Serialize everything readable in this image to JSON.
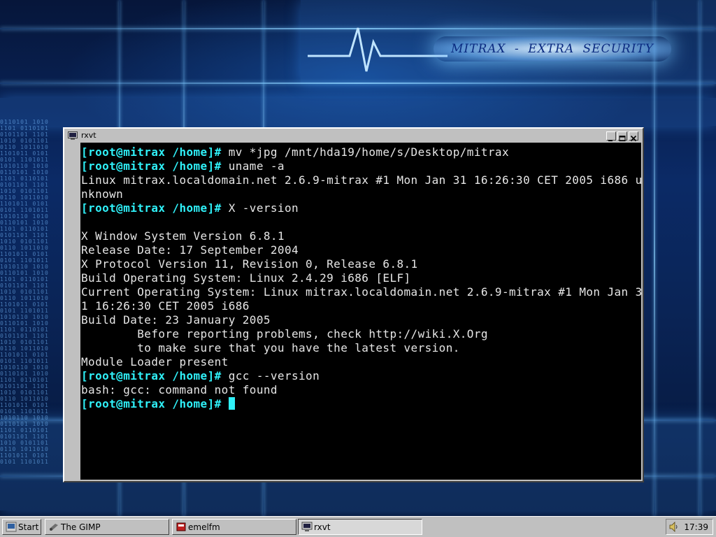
{
  "wallpaper": {
    "banner_text": "MITRAX - EXTRA SECURITY",
    "binary_text": "0110101 1010\n1101 0110101\n0101101 1101\n1010 0101101\n0110 1011010\n1101011 0101\n0101 1101011\n1010110 1010\n0110101 1010\n1101 0110101\n0101101 1101\n1010 0101101\n0110 1011010\n1101011 0101\n0101 1101011\n1010110 1010\n0110101 1010\n1101 0110101\n0101101 1101\n1010 0101101\n0110 1011010\n1101011 0101\n0101 1101011\n1010110 1010\n0110101 1010\n1101 0110101\n0101101 1101\n1010 0101101\n0110 1011010\n1101011 0101\n0101 1101011\n1010110 1010\n0110101 1010\n1101 0110101\n0101101 1101\n1010 0101101\n0110 1011010\n1101011 0101\n0101 1101011\n1010110 1010\n0110101 1010\n1101 0110101\n0101101 1101\n1010 0101101\n0110 1011010\n1101011 0101\n0101 1101011\n1010110 1010\n0110101 1010\n1101 0110101\n0101101 1101\n1010 0101101\n0110 1011010\n1101011 0101\n0101 1101011"
  },
  "window": {
    "title": "rxvt",
    "icon": "terminal-icon",
    "buttons": [
      "minimize",
      "maximize",
      "close"
    ]
  },
  "terminal": {
    "prompt": "[root@mitrax /home]#",
    "lines": [
      {
        "prompt": "[root@mitrax /home]#",
        "text": " mv *jpg /mnt/hda19/home/s/Desktop/mitrax"
      },
      {
        "prompt": "[root@mitrax /home]#",
        "text": " uname -a"
      },
      {
        "prompt": "",
        "text": "Linux mitrax.localdomain.net 2.6.9-mitrax #1 Mon Jan 31 16:26:30 CET 2005 i686 u"
      },
      {
        "prompt": "",
        "text": "nknown"
      },
      {
        "prompt": "[root@mitrax /home]#",
        "text": " X -version"
      },
      {
        "prompt": "",
        "text": ""
      },
      {
        "prompt": "",
        "text": "X Window System Version 6.8.1"
      },
      {
        "prompt": "",
        "text": "Release Date: 17 September 2004"
      },
      {
        "prompt": "",
        "text": "X Protocol Version 11, Revision 0, Release 6.8.1"
      },
      {
        "prompt": "",
        "text": "Build Operating System: Linux 2.4.29 i686 [ELF]"
      },
      {
        "prompt": "",
        "text": "Current Operating System: Linux mitrax.localdomain.net 2.6.9-mitrax #1 Mon Jan 3"
      },
      {
        "prompt": "",
        "text": "1 16:26:30 CET 2005 i686"
      },
      {
        "prompt": "",
        "text": "Build Date: 23 January 2005"
      },
      {
        "prompt": "",
        "text": "        Before reporting problems, check http://wiki.X.Org"
      },
      {
        "prompt": "",
        "text": "        to make sure that you have the latest version."
      },
      {
        "prompt": "",
        "text": "Module Loader present"
      },
      {
        "prompt": "[root@mitrax /home]#",
        "text": " gcc --version"
      },
      {
        "prompt": "",
        "text": "bash: gcc: command not found"
      },
      {
        "prompt": "[root@mitrax /home]#",
        "text": " ",
        "cursor": true
      }
    ],
    "colors": {
      "prompt": "#2ff0f8",
      "text": "#e6e6e6",
      "background": "#000000"
    }
  },
  "taskbar": {
    "start_label": "Start",
    "tasks": [
      {
        "label": "The GIMP",
        "icon": "gimp-icon",
        "active": false
      },
      {
        "label": "emelfm",
        "icon": "file-manager-icon",
        "active": false
      },
      {
        "label": "rxvt",
        "icon": "terminal-icon",
        "active": true
      }
    ],
    "tray": {
      "volume_icon": "speaker-icon",
      "clock": "17:39"
    }
  }
}
